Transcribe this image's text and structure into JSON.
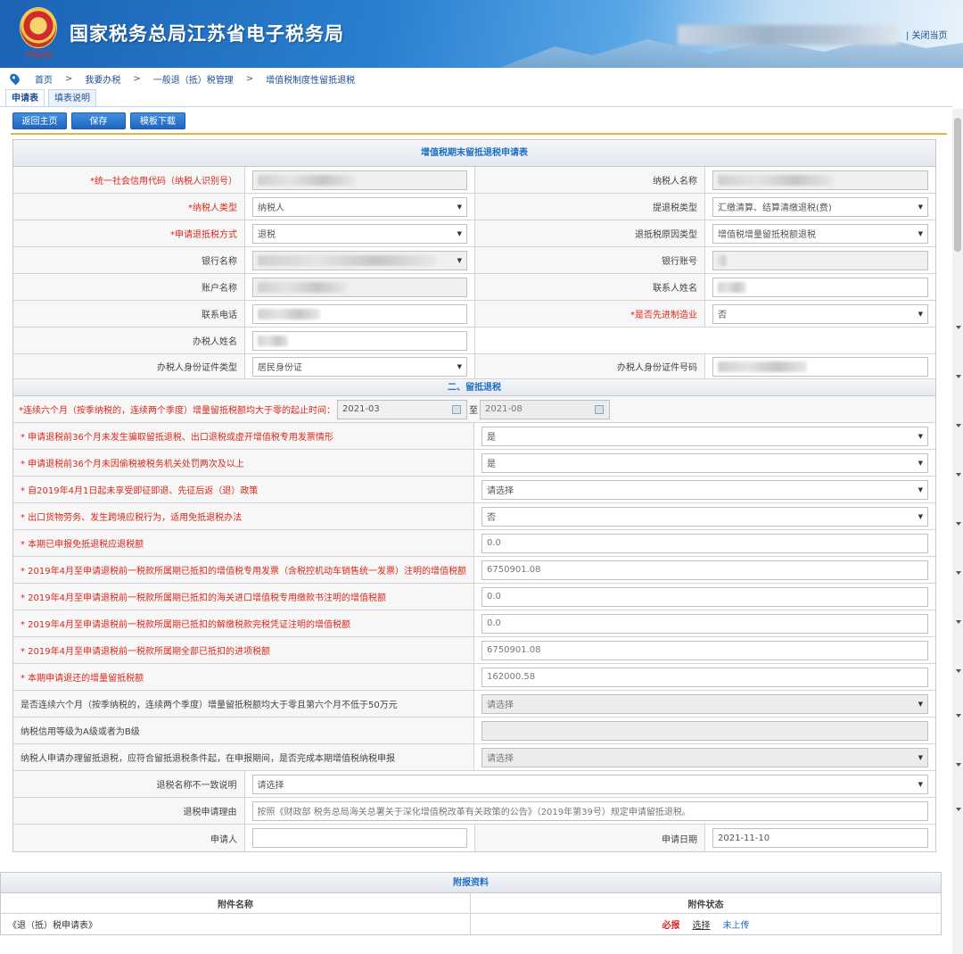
{
  "header": {
    "title": "国家税务总局江苏省电子税务局",
    "emblem_text": "中国税务",
    "close_page": "| 关闭当页"
  },
  "breadcrumb": [
    "首页",
    ">",
    "我要办税",
    ">",
    "一般退（抵）税管理",
    ">",
    "增值税制度性留抵退税"
  ],
  "tabs": [
    "申请表",
    "填表说明"
  ],
  "toolbar": {
    "back": "返回主页",
    "save": "保存",
    "download": "模板下载"
  },
  "form": {
    "title": "增值税期末留抵退税申请表",
    "section2": "二、留抵退税",
    "credit_code_label": "*统一社会信用代码（纳税人识别号）",
    "taxpayer_name_label": "纳税人名称",
    "taxpayer_type_label": "*纳税人类型",
    "taxpayer_type_value": "纳税人",
    "refund_type_label": "提退税类型",
    "refund_type_value": "汇缴清算、结算清缴退税(费)",
    "method_label": "*申请退抵税方式",
    "method_value": "退税",
    "reason_type_label": "退抵税原因类型",
    "reason_type_value": "增值税增量留抵税额退税",
    "bank_name_label": "银行名称",
    "bank_account_label": "银行账号",
    "account_name_label": "账户名称",
    "contact_name_label": "联系人姓名",
    "phone_label": "联系电话",
    "advanced_mfg_label": "*是否先进制造业",
    "advanced_mfg_value": "否",
    "handler_name_label": "办税人姓名",
    "handler_id_type_label": "办税人身份证件类型",
    "handler_id_type_value": "居民身份证",
    "handler_id_no_label": "办税人身份证件号码",
    "period_label": "*连续六个月（按季纳税的，连续两个季度）增量留抵税额均大于零的起止时间：",
    "period_from": "2021-03",
    "period_to_sep": "至",
    "period_to": "2021-08",
    "questions": [
      {
        "label": "* 申请退税前36个月未发生骗取留抵退税、出口退税或虚开增值税专用发票情形",
        "value": "是",
        "kind": "select"
      },
      {
        "label": "* 申请退税前36个月未因偷税被税务机关处罚两次及以上",
        "value": "是",
        "kind": "select"
      },
      {
        "label": "* 自2019年4月1日起未享受即征即退、先征后返（退）政策",
        "value": "请选择",
        "kind": "select"
      },
      {
        "label": "* 出口货物劳务、发生跨境应税行为，适用免抵退税办法",
        "value": "否",
        "kind": "select"
      },
      {
        "label": "* 本期已申报免抵退税应退税额",
        "value": "0.0",
        "kind": "input"
      },
      {
        "label": "* 2019年4月至申请退税前一税款所属期已抵扣的增值税专用发票（含税控机动车销售统一发票）注明的增值税额",
        "value": "6750901.08",
        "kind": "input"
      },
      {
        "label": "* 2019年4月至申请退税前一税款所属期已抵扣的海关进口增值税专用缴款书注明的增值税额",
        "value": "0.0",
        "kind": "input"
      },
      {
        "label": "* 2019年4月至申请退税前一税款所属期已抵扣的解缴税款完税凭证注明的增值税额",
        "value": "0.0",
        "kind": "input"
      },
      {
        "label": "* 2019年4月至申请退税前一税款所属期全部已抵扣的进项税额",
        "value": "6750901.08",
        "kind": "input"
      },
      {
        "label": "* 本期申请退还的增量留抵税额",
        "value": "162000.58",
        "kind": "input"
      },
      {
        "label": "是否连续六个月（按季纳税的，连续两个季度）增量留抵税额均大于零且第六个月不低于50万元",
        "value": "请选择",
        "kind": "disabled-select"
      },
      {
        "label": "纳税信用等级为A级或者为B级",
        "value": "",
        "kind": "disabled-input"
      },
      {
        "label": "纳税人申请办理留抵退税，应符合留抵退税条件起，在申报期间，是否完成本期增值税纳税申报",
        "value": "请选择",
        "kind": "disabled-select"
      }
    ],
    "mismatch_label": "退税名称不一致说明",
    "mismatch_value": "请选择",
    "reason_label": "退税申请理由",
    "reason_value": "按照《财政部 税务总局海关总署关于深化增值税改革有关政策的公告》（2019年第39号）规定申请留抵退税。",
    "applicant_label": "申请人",
    "apply_date_label": "申请日期",
    "apply_date_value": "2021-11-10"
  },
  "attachments": {
    "title": "附报资料",
    "col_name": "附件名称",
    "col_status": "附件状态",
    "rows": [
      {
        "name": "《退（抵）税申请表》",
        "must": "必报",
        "choose": "选择",
        "status": "未上传"
      }
    ]
  },
  "colors": {
    "accent": "#1d6fc4",
    "required": "#d9281e",
    "gold": "#e0b645"
  }
}
